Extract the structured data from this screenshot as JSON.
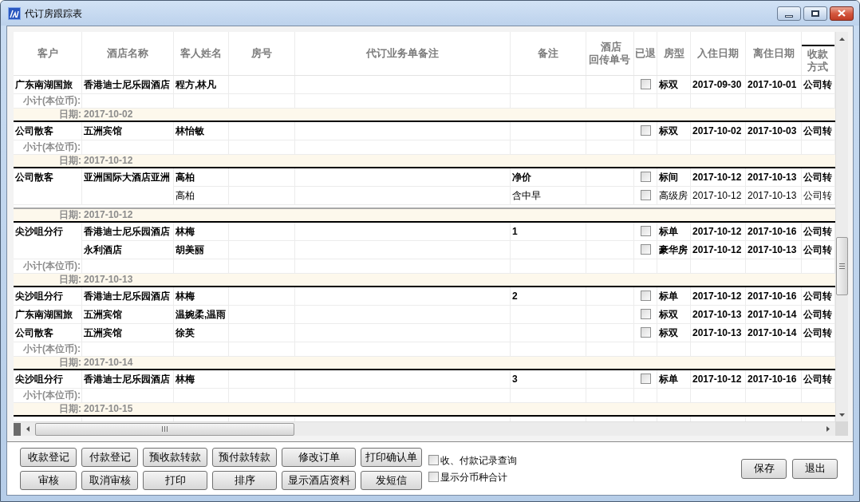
{
  "window": {
    "title": "代订房跟踪表"
  },
  "table": {
    "columns": [
      {
        "label": "客户",
        "marked": false
      },
      {
        "label": "酒店名称",
        "marked": false
      },
      {
        "label": "客人姓名",
        "marked": false
      },
      {
        "label": "房号",
        "marked": false
      },
      {
        "label": "代订业务单备注",
        "marked": false
      },
      {
        "label": "备注",
        "marked": false
      },
      {
        "label": "酒店回传单号",
        "marked": false
      },
      {
        "label": "已退",
        "marked": false
      },
      {
        "label": "房型",
        "marked": false
      },
      {
        "label": "入住日期",
        "marked": false
      },
      {
        "label": "离住日期",
        "marked": false
      },
      {
        "label": "收款方式",
        "marked": true
      }
    ],
    "rows": [
      {
        "kind": "booking",
        "customer": "广东南湖国旅",
        "hotels": [
          {
            "name": "香港迪士尼乐园酒店",
            "rooms": [
              {
                "guest": "程方,林凡",
                "checked": false,
                "room_type": "标双",
                "check_in": "2017-09-30",
                "check_out": "2017-10-01",
                "payment": "公司转",
                "bold": true
              }
            ]
          }
        ]
      },
      {
        "kind": "subtotal",
        "label": "小计(本位币):"
      },
      {
        "kind": "date",
        "label": "日期:",
        "value": "2017-10-02"
      },
      {
        "kind": "booking",
        "customer": "公司散客",
        "hotels": [
          {
            "name": "五洲宾馆",
            "rooms": [
              {
                "guest": "林怡敏",
                "checked": false,
                "room_type": "标双",
                "check_in": "2017-10-02",
                "check_out": "2017-10-03",
                "payment": "公司转",
                "bold": true
              }
            ]
          }
        ]
      },
      {
        "kind": "subtotal",
        "label": "小计(本位币):"
      },
      {
        "kind": "date",
        "label": "日期:",
        "value": "2017-10-12"
      },
      {
        "kind": "booking",
        "customer": "公司散客",
        "hotels": [
          {
            "name": "亚洲国际大酒店亚洲",
            "rooms": [
              {
                "guest": "高柏",
                "note": "净价",
                "checked": false,
                "room_type": "标间",
                "check_in": "2017-10-12",
                "check_out": "2017-10-13",
                "payment": "公司转",
                "bold": true
              },
              {
                "guest": "高柏",
                "note": "含中早",
                "checked": false,
                "room_type": "高级房",
                "check_in": "2017-10-12",
                "check_out": "2017-10-13",
                "payment": "公司转",
                "bold": false
              }
            ]
          }
        ]
      },
      {
        "kind": "divider"
      },
      {
        "kind": "date",
        "label": "日期:",
        "value": "2017-10-12"
      },
      {
        "kind": "booking",
        "customer": "尖沙咀分行",
        "hotels": [
          {
            "name": "香港迪士尼乐园酒店",
            "rooms": [
              {
                "guest": "林梅",
                "note": "1",
                "checked": false,
                "room_type": "标单",
                "check_in": "2017-10-12",
                "check_out": "2017-10-16",
                "payment": "公司转",
                "bold": true
              }
            ]
          },
          {
            "name": "永利酒店",
            "rooms": [
              {
                "guest": "胡美丽",
                "checked": false,
                "room_type": "豪华房",
                "check_in": "2017-10-12",
                "check_out": "2017-10-13",
                "payment": "公司转",
                "bold": true
              }
            ]
          }
        ]
      },
      {
        "kind": "subtotal",
        "label": "小计(本位币):"
      },
      {
        "kind": "date",
        "label": "日期:",
        "value": "2017-10-13"
      },
      {
        "kind": "booking",
        "customer": "尖沙咀分行",
        "hotels": [
          {
            "name": "香港迪士尼乐园酒店",
            "rooms": [
              {
                "guest": "林梅",
                "note": "2",
                "checked": false,
                "room_type": "标单",
                "check_in": "2017-10-12",
                "check_out": "2017-10-16",
                "payment": "公司转",
                "bold": true
              }
            ]
          }
        ]
      },
      {
        "kind": "booking",
        "customer": "广东南湖国旅",
        "hotels": [
          {
            "name": "五洲宾馆",
            "rooms": [
              {
                "guest": "温婉柔,温雨",
                "checked": false,
                "room_type": "标双",
                "check_in": "2017-10-13",
                "check_out": "2017-10-14",
                "payment": "公司转",
                "bold": true
              }
            ]
          }
        ]
      },
      {
        "kind": "booking",
        "customer": "公司散客",
        "hotels": [
          {
            "name": "五洲宾馆",
            "rooms": [
              {
                "guest": "徐英",
                "checked": false,
                "room_type": "标双",
                "check_in": "2017-10-13",
                "check_out": "2017-10-14",
                "payment": "公司转",
                "bold": true
              }
            ]
          }
        ]
      },
      {
        "kind": "subtotal",
        "label": "小计(本位币):"
      },
      {
        "kind": "date",
        "label": "日期:",
        "value": "2017-10-14"
      },
      {
        "kind": "booking",
        "customer": "尖沙咀分行",
        "hotels": [
          {
            "name": "香港迪士尼乐园酒店",
            "rooms": [
              {
                "guest": "林梅",
                "note": "3",
                "checked": false,
                "room_type": "标单",
                "check_in": "2017-10-12",
                "check_out": "2017-10-16",
                "payment": "公司转",
                "bold": true
              }
            ]
          }
        ]
      },
      {
        "kind": "subtotal",
        "label": "小计(本位币):"
      },
      {
        "kind": "date",
        "label": "日期:",
        "value": "2017-10-15"
      }
    ]
  },
  "footer": {
    "buttons": [
      "收款登记",
      "付款登记",
      "预收款转款",
      "预付款转款",
      "修改订单",
      "打印确认单",
      "审核",
      "取消审核",
      "打印",
      "排序",
      "显示酒店资料",
      "发短信"
    ],
    "options": [
      {
        "label": "收、付款记录查询",
        "checked": false
      },
      {
        "label": "显示分币种合计",
        "checked": false
      }
    ],
    "dialog_buttons": [
      "保存",
      "退出"
    ]
  }
}
